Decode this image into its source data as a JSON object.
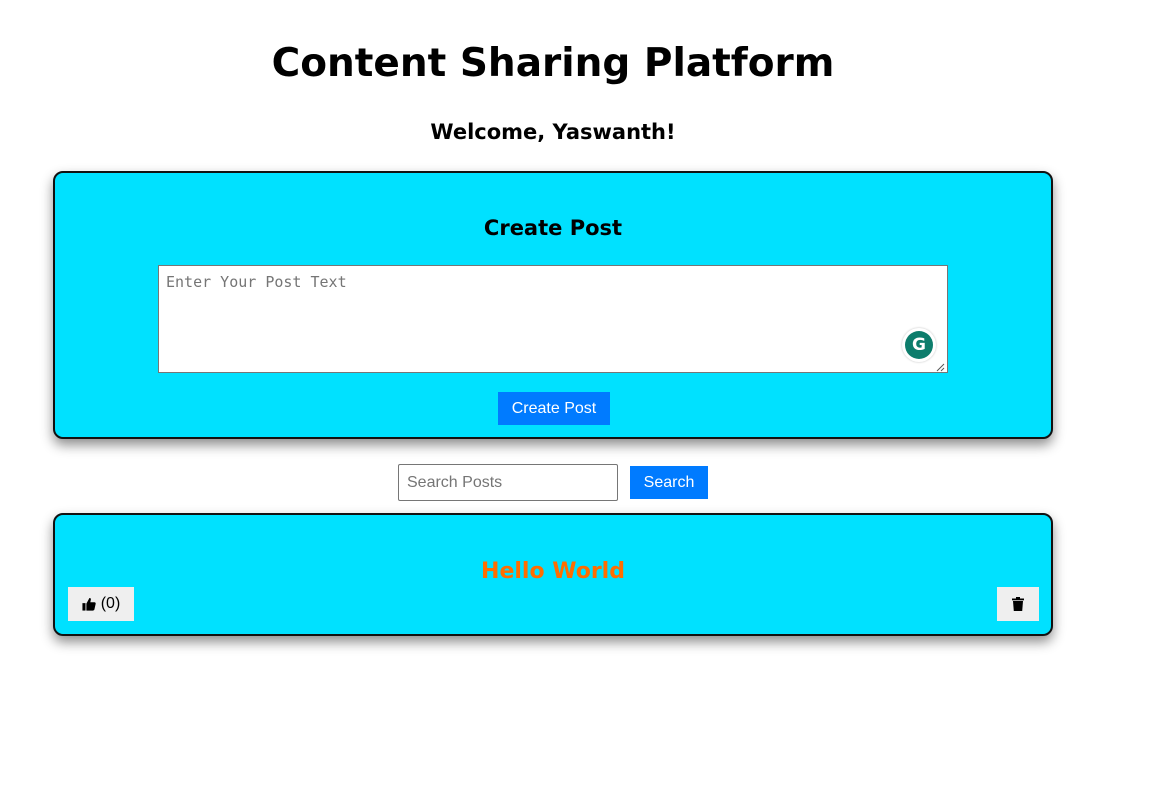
{
  "header": {
    "title": "Content Sharing Platform",
    "welcome": "Welcome, Yaswanth!"
  },
  "create_post": {
    "heading": "Create Post",
    "placeholder": "Enter Your Post Text",
    "value": "",
    "button_label": "Create Post"
  },
  "search": {
    "placeholder": "Search Posts",
    "value": "",
    "button_label": "Search"
  },
  "posts": [
    {
      "text": "Hello World",
      "likes_label": "(0)",
      "like_icon": "thumbs-up-icon",
      "delete_icon": "trash-icon"
    }
  ],
  "colors": {
    "card_background": "#00e1ff",
    "primary_button": "#007bff",
    "post_text": "#ff6d00",
    "grammarly": "#0d7d6c"
  },
  "extension": {
    "grammarly_glyph": "G"
  }
}
